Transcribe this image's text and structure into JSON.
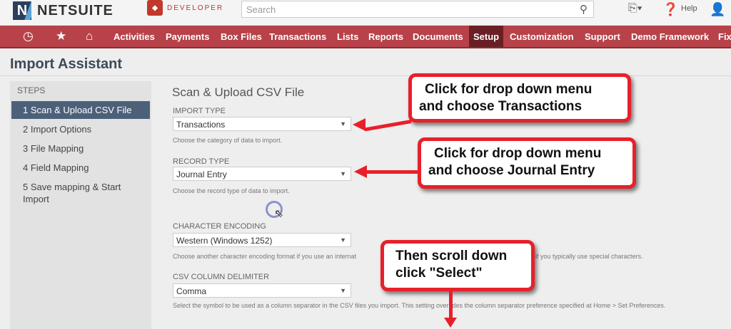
{
  "header": {
    "logo_text": "NETSUITE",
    "dev_text": "DEVELOPER",
    "search_placeholder": "Search",
    "help_label": "Help"
  },
  "nav": {
    "items": [
      "Activities",
      "Payments",
      "Box Files",
      "Transactions",
      "Lists",
      "Reports",
      "Documents",
      "Setup",
      "Customization",
      "Support",
      "Demo Framework",
      "Fix"
    ],
    "active": "Setup"
  },
  "page": {
    "title": "Import Assistant"
  },
  "steps": {
    "title": "STEPS",
    "items": [
      "1 Scan & Upload CSV File",
      "2 Import Options",
      "3 File Mapping",
      "4 Field Mapping",
      "5 Save mapping & Start Import"
    ]
  },
  "form": {
    "section_title": "Scan & Upload CSV File",
    "import_type": {
      "label": "IMPORT TYPE",
      "value": "Transactions",
      "help": "Choose the category of data to import."
    },
    "record_type": {
      "label": "RECORD TYPE",
      "value": "Journal Entry",
      "help": "Choose the record type of data to import."
    },
    "encoding": {
      "label": "CHARACTER ENCODING",
      "value": "Western (Windows 1252)",
      "help_left": "Choose another character encoding format if you use an internat",
      "help_right": "if you typically use special characters."
    },
    "delimiter": {
      "label": "CSV COLUMN DELIMITER",
      "value": "Comma",
      "help": "Select the symbol to be used as a column separator in the CSV files you import. This setting overrides the column separator preference specified at Home > Set Preferences."
    }
  },
  "callouts": {
    "c1": [
      "Click for drop down menu",
      "and choose Transactions"
    ],
    "c2": [
      "Click for drop down menu",
      "and choose Journal Entry"
    ],
    "c3": [
      "Then scroll down",
      "click \"Select\""
    ]
  },
  "colors": {
    "nav": "#b84249",
    "callout_border": "#e8202a",
    "step_active": "#4d607a"
  }
}
